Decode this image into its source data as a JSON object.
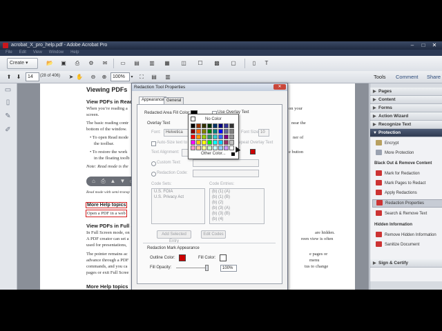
{
  "window": {
    "title": "acrobat_X_pro_help.pdf - Adobe Acrobat Pro",
    "controls": [
      "–",
      "□",
      "✕"
    ]
  },
  "menu": [
    "File",
    "Edit",
    "View",
    "Window",
    "Help"
  ],
  "toolbar": {
    "create_label": "Create",
    "page_number": "14",
    "page_count": "(28 of 406)",
    "zoom": "100%",
    "tools_label": "Tools",
    "comment_label": "Comment",
    "share_label": "Share"
  },
  "document": {
    "heading1": "Viewing PDFs",
    "sub1": "View PDFs in Read",
    "para1a": "When you’re reading a",
    "para1a_end": "on your",
    "para1b": "screen.",
    "para2a": "The basic reading contr",
    "para2a_end": "near the",
    "para2b": "bottom of the window.",
    "bullet1a": "To open Read mode",
    "bullet1a_end": "ner of",
    "bullet1b": "the toolbar.",
    "bullet2a": "To restore the work",
    "bullet2a_end": "e button",
    "bullet2b": "in the floating toolb",
    "note": "Note: Read mode is the",
    "caption": "Read mode with semi-transp",
    "more_help": "More Help topics",
    "open_link": "Open a PDF in a web",
    "heading2": "View PDFs in Full S",
    "para3a": "In Full Screen mode, on",
    "para3a_end": "are hidden.",
    "para3b": "A PDF creator can set a",
    "para3b_end": "reen view is often",
    "para3c": "used for presentations,",
    "para4a": "The pointer remains ac",
    "para4a_end": "e pages or",
    "para4b": "advance through a PDF",
    "para4b_end": "menu",
    "para4c": "commands, and you ca",
    "para4c_end": "tus to change",
    "para4d": "pages or exit Full Scree",
    "heading3": "More Help topics"
  },
  "right_panel": {
    "sections": [
      "Pages",
      "Content",
      "Forms",
      "Action Wizard",
      "Recognize Text",
      "Protection"
    ],
    "protection_items": [
      "Encrypt",
      "More Protection"
    ],
    "black_out_header": "Black Out & Remove Content",
    "black_out_items": [
      "Mark for Redaction",
      "Mark Pages to Redact",
      "Apply Redactions",
      "Redaction Properties",
      "Search & Remove Text"
    ],
    "hidden_header": "Hidden Information",
    "hidden_items": [
      "Remove Hidden Information",
      "Sanitize Document"
    ],
    "bottom_section": "Sign & Certify"
  },
  "dialog": {
    "title": "Redaction Tool Properties",
    "tabs": [
      "Appearance",
      "General"
    ],
    "fill_color_label": "Redacted Area Fill Color:",
    "use_overlay_label": "Use Overlay Text",
    "overlay_group": "Overlay Text",
    "font_label": "Font:",
    "font_value": "Helvetica",
    "font_size_label": "Font Size:",
    "font_size_value": "10",
    "autosize_label": "Auto-Size text to fit",
    "repeat_label": "Repeat Overlay Text",
    "text_align_label": "Text Alignment:",
    "custom_text_label": "Custom Text:",
    "redaction_code_label": "Redaction Code:",
    "code_sets_label": "Code Sets:",
    "code_entries_label": "Code Entries:",
    "code_sets": [
      "U.S. FOIA",
      "U.S. Privacy Act"
    ],
    "code_entries": [
      "(b) (1) (A)",
      "(b) (1) (B)",
      "(b) (2)",
      "(b) (3) (A)",
      "(b) (3) (B)",
      "(b) (4)"
    ],
    "add_entry_btn": "Add Selected Entry",
    "edit_codes_btn": "Edit Codes",
    "mark_group": "Redaction Mark Appearance",
    "outline_color_label": "Outline Color:",
    "fill_color2_label": "Fill Color:",
    "opacity_label": "Fill Opacity:",
    "opacity_value": "100%",
    "close_symbol": "✕"
  },
  "palette": {
    "no_color": "No Color",
    "other_color": "Other Color...",
    "colors": [
      "#000000",
      "#993300",
      "#333300",
      "#003300",
      "#003366",
      "#000080",
      "#333399",
      "#333333",
      "#800000",
      "#ff6600",
      "#808000",
      "#008000",
      "#008080",
      "#0000ff",
      "#666699",
      "#808080",
      "#ff0000",
      "#ff9900",
      "#99cc00",
      "#339966",
      "#33cccc",
      "#3366ff",
      "#800080",
      "#969696",
      "#ff00ff",
      "#ffcc00",
      "#ffff00",
      "#00ff00",
      "#00ffff",
      "#00ccff",
      "#993366",
      "#c0c0c0",
      "#ff99cc",
      "#ffcc99",
      "#ffff99",
      "#ccffcc",
      "#ccffff",
      "#99ccff",
      "#cc99ff",
      "#ffffff"
    ]
  }
}
